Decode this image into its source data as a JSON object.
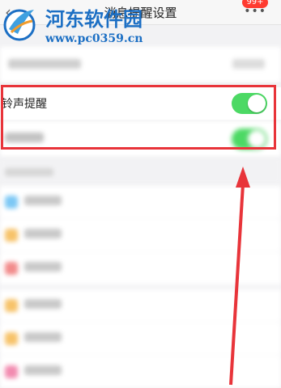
{
  "header": {
    "title": "消息提醒设置",
    "badge": "99+",
    "more_icon": "more-dots-icon",
    "back_icon": "chevron-left-icon"
  },
  "watermark": {
    "name": "河东软件园",
    "url": "www.pc0359.cn"
  },
  "settings": {
    "ring": {
      "label": "铃声提醒",
      "enabled": true
    },
    "vibrate": {
      "enabled": true
    }
  },
  "colors": {
    "toggle_on": "#4cd964",
    "highlight": "#e8343a",
    "brand": "#1c6fc4"
  },
  "list": [
    {
      "icon_color": "#7cc8f5"
    },
    {
      "icon_color": "#f7c36a"
    },
    {
      "icon_color": "#f28b8b"
    },
    {
      "icon_color": "#f7c36a"
    },
    {
      "icon_color": "#f7c36a"
    },
    {
      "icon_color": "#f28bb0"
    }
  ]
}
